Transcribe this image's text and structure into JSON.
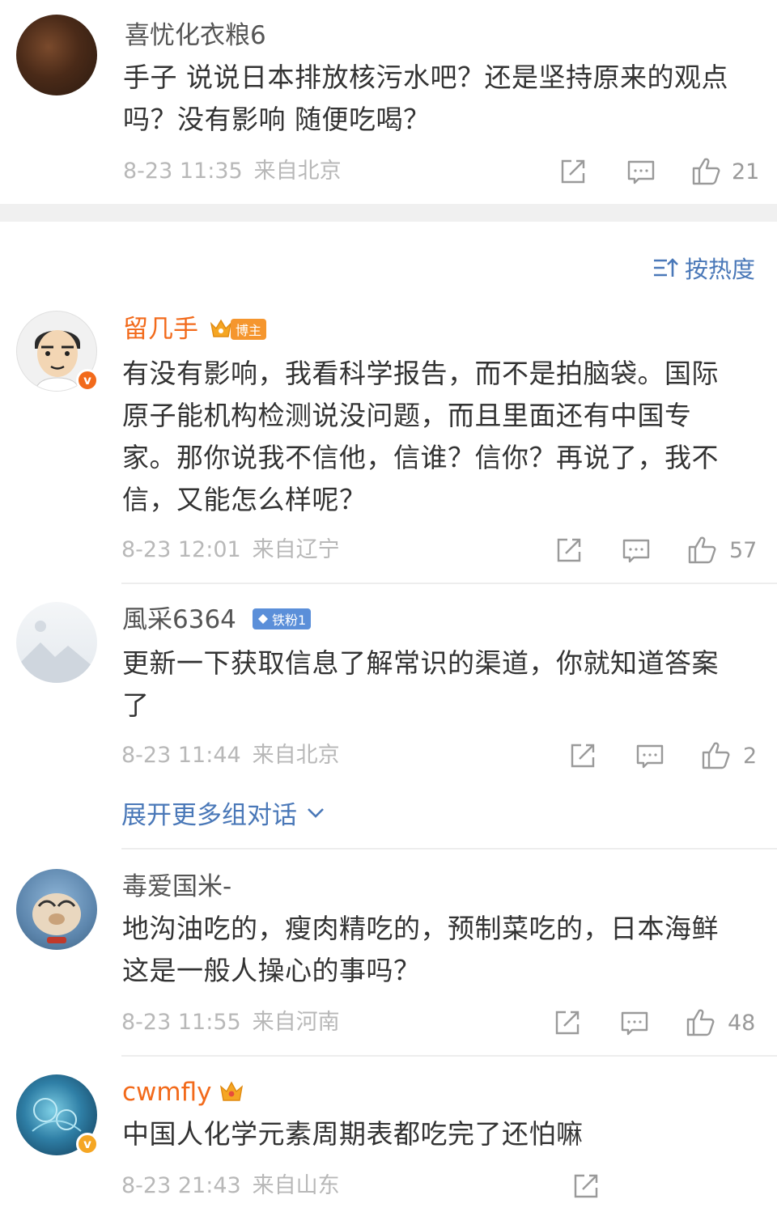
{
  "colors": {
    "link_blue": "#4a78b8",
    "vip_orange": "#f26a1b",
    "verified_orange": "#f5a623",
    "fan_badge_blue": "#5b8fd9"
  },
  "sort": {
    "label": "按热度",
    "icon": "sort-icon"
  },
  "expand_more": {
    "label": "展开更多组对话",
    "icon": "chevron-down-icon"
  },
  "comments": [
    {
      "username": "喜忧化衣粮6",
      "text": "手子 说说日本排放核污水吧？还是坚持原来的观点吗？没有影响 随便吃喝？",
      "date": "8-23 11:35",
      "source": "来自北京",
      "likes": "21"
    },
    {
      "username": "留几手",
      "badge": "博主",
      "text": "有没有影响，我看科学报告，而不是拍脑袋。国际原子能机构检测说没问题，而且里面还有中国专家。那你说我不信他，信谁？信你？再说了，我不信，又能怎么样呢？",
      "date": "8-23 12:01",
      "source": "来自辽宁",
      "likes": "57"
    },
    {
      "username": "風采6364",
      "badge": "铁粉1",
      "text": "更新一下获取信息了解常识的渠道，你就知道答案了",
      "date": "8-23 11:44",
      "source": "来自北京",
      "likes": "2"
    },
    {
      "username": "毒爱国米-",
      "text": "地沟油吃的，瘦肉精吃的，预制菜吃的，日本海鲜这是一般人操心的事吗？",
      "date": "8-23 11:55",
      "source": "来自河南",
      "likes": "48"
    },
    {
      "username": "cwmfly",
      "text": "中国人化学元素周期表都吃完了还怕嘛",
      "date": "8-23 21:43",
      "source": "来自山东"
    }
  ]
}
